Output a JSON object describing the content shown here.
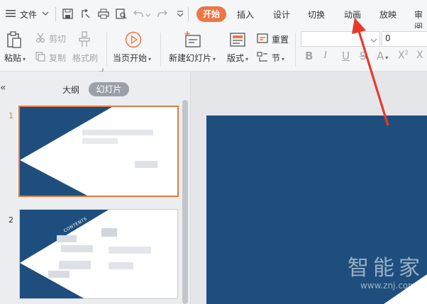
{
  "menu": {
    "label": "文件"
  },
  "tabs": [
    "开始",
    "插入",
    "设计",
    "切换",
    "动画",
    "放映",
    "审阅"
  ],
  "active_tab": "开始",
  "ribbon": {
    "paste": "粘贴",
    "cut": "剪切",
    "copy": "复制",
    "format_painter": "格式刷",
    "from_current": "当页开始",
    "new_slide": "新建幻灯片",
    "layout": "版式",
    "reset": "重置",
    "section": "节",
    "font_size": "0"
  },
  "panel": {
    "outline_tab": "大纲",
    "slides_tab": "幻灯片",
    "collapse": "«"
  },
  "slides": [
    {
      "number": "1"
    },
    {
      "number": "2",
      "title_text": "CONTENTS"
    }
  ],
  "watermark": {
    "brand": "智能家",
    "url": "www.znj.com"
  },
  "colors": {
    "accent": "#ee7545",
    "slide_blue": "#1e4e7d",
    "arrow_red": "#e83a2b"
  }
}
